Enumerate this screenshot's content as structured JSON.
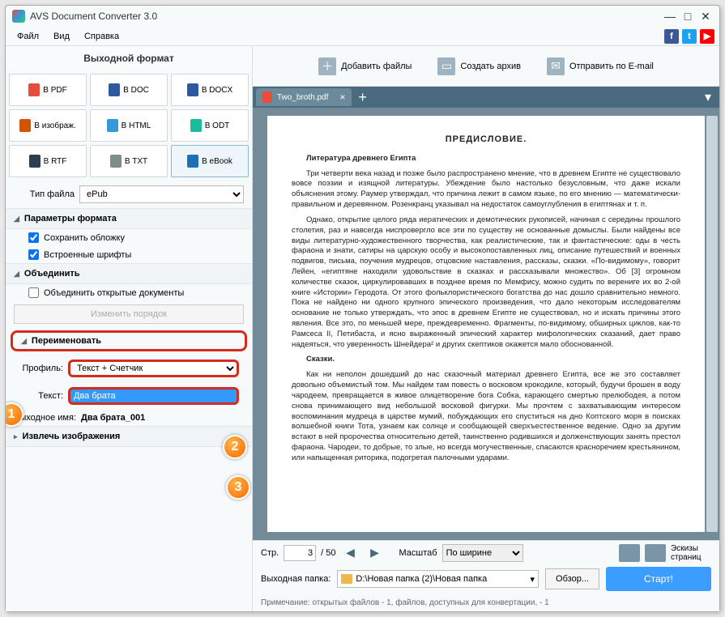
{
  "title": "AVS Document Converter 3.0",
  "menu": {
    "file": "Файл",
    "view": "Вид",
    "help": "Справка"
  },
  "left": {
    "header": "Выходной формат",
    "formats": [
      "В PDF",
      "В DOC",
      "В DOCX",
      "В изображ.",
      "В HTML",
      "В ODT",
      "В RTF",
      "В TXT",
      "В eBook"
    ],
    "filetype_label": "Тип файла",
    "filetype_value": "ePub",
    "sec_format": "Параметры формата",
    "opt_savecover": "Сохранить обложку",
    "opt_embedfonts": "Встроенные шрифты",
    "sec_merge": "Объединить",
    "opt_mergeopen": "Объединить открытые документы",
    "change_order": "Изменить порядок",
    "sec_rename": "Переименовать",
    "profile_label": "Профиль:",
    "profile_value": "Текст + Счетчик",
    "text_label": "Текст:",
    "text_value": "Два брата",
    "outname_label": "Выходное имя:",
    "outname_value": "Два брата_001",
    "sec_extract": "Извлечь изображения"
  },
  "toolbar": {
    "add": "Добавить файлы",
    "archive": "Создать архив",
    "email": "Отправить по E-mail"
  },
  "tab": {
    "name": "Two_broth.pdf"
  },
  "preview": {
    "title": "ПРЕДИСЛОВИЕ.",
    "h1": "Литература древнего Египта",
    "p1": "Три четверти века назад и позже было распространено мнение, что в древнем Египте не существовало вовсе поэзии и изящной литературы. Убеждение было настолько безусловным, что даже искали объяснения этому. Раумер утверждал, что причина лежит в самом языке, по его мнению — математически-правильном и деревянном. Розенкранц указывал на недостаток самоуглубления в египтянах и т. п.",
    "p2": "Однако, открытие целого ряда иератических и демотических рукописей, начиная с середины прошлого столетия, раз и навсегда ниспровергло все эти по существу не основанные домыслы. Были найдены все виды литературно-художественного творчества, как реалистические, так и фантастические: оды в честь фараона и знати, сатиры на царскую особу и высокопоставленных лиц, описание путешествий и военных подвигов, письма, поучения мудрецов, отцовские наставления, рассказы, сказки. «По-видимому», говорит Лейен, «египтяне находили удовольствие в сказках и рассказывали множество». Об [3] огромном количестве сказок, циркулировавших в позднее время по Мемфису, можно судить по верениге их во 2-ой книге «Истории» Геродота. От этого фольклористического богатства до нас дошло сравнительно немного. Пока не найдено ни одного крупного эпического произведения, что дало некоторым исследователям основание не только утверждать, что эпос в древнем Египте не существовал, но и искать причины этого явления. Все это, по меньшей мере, преждевременно. Фрагменты, по-видимому, обширных циклов, как-то Рамсеса II, Петибаста, и ясно выраженный эпический характер мифологических сказаний, дает право надеяться, что уверенность Шнейдера² и других скептиков окажется мало обоснованной.",
    "h2": "Сказки.",
    "p3": "Как ни неполон дошедший до нас сказочный материал древнего Египта, все же это составляет довольно объемистый том. Мы найдем там повесть о восковом крокодиле, который, будучи брошен в воду чародеем, превращается в живое олицетворение бога Собка, карающего смертью прелюбодея, а потом снова принимающего вид небольшой восковой фигурки. Мы прочтем с захватывающим интересом воспоминания мудреца в царстве мумий, побуждающих его спуститься на дно Коптского моря в поисках волшебной книги Тота, узнаем как солнце и сообщающей сверхъестественное ведение. Одно за другим встают в ней пророчества относительно детей, таинственно родившихся и долженствующих занять престол фараона. Чародеи, то добрые, то злые, но всегда могучественные, спасаются красноречием крестьянином, или напыщенная риторика, подогретая палочными ударами."
  },
  "footer": {
    "page_label": "Стр.",
    "page_current": "3",
    "page_total": "/ 50",
    "zoom_label": "Масштаб",
    "zoom_value": "По ширине",
    "thumbs": "Эскизы страниц",
    "outfolder_label": "Выходная папка:",
    "outfolder_path": "D:\\Новая папка (2)\\Новая папка",
    "browse": "Обзор...",
    "start": "Старт!",
    "note": "Примечание: открытых файлов - 1, файлов, доступных для конвертации, - 1"
  }
}
